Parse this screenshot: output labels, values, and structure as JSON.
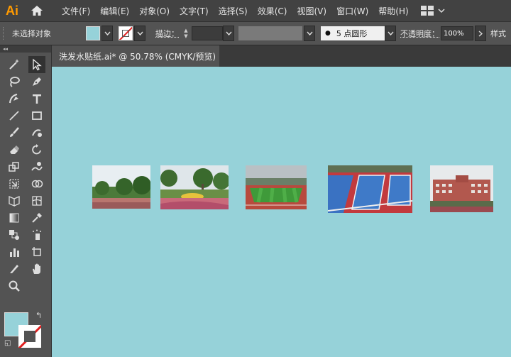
{
  "app": {
    "logo": "Ai"
  },
  "menu": {
    "items": [
      "文件(F)",
      "编辑(E)",
      "对象(O)",
      "文字(T)",
      "选择(S)",
      "效果(C)",
      "视图(V)",
      "窗口(W)",
      "帮助(H)"
    ]
  },
  "control": {
    "no_selection": "未选择对象",
    "stroke_label": "描边：",
    "brush_value": "5 点圆形",
    "opacity_label": "不透明度：",
    "opacity_value": "100%",
    "style_label": "样式"
  },
  "document": {
    "tab_title": "洗发水贴纸.ai* @ 50.78% (CMYK/预览)"
  },
  "colors": {
    "fill": "#96d2d9",
    "canvas": "#96d2d9",
    "stroke": "none"
  },
  "tools": [
    "magic-wand",
    "direct-selection",
    "lasso",
    "pen",
    "curvature",
    "type",
    "line",
    "rectangle",
    "paintbrush",
    "shaper",
    "eraser",
    "rotate",
    "scale",
    "warp",
    "free-transform",
    "shape-builder",
    "perspective-grid",
    "mesh",
    "gradient",
    "eyedropper",
    "blend",
    "symbol-sprayer",
    "column-graph",
    "artboard",
    "slice",
    "hand",
    "zoom"
  ],
  "canvas_images": [
    "garden-trees-photo",
    "flower-garden-photo",
    "sports-field-photo",
    "basketball-courts-photo",
    "school-building-photo"
  ]
}
